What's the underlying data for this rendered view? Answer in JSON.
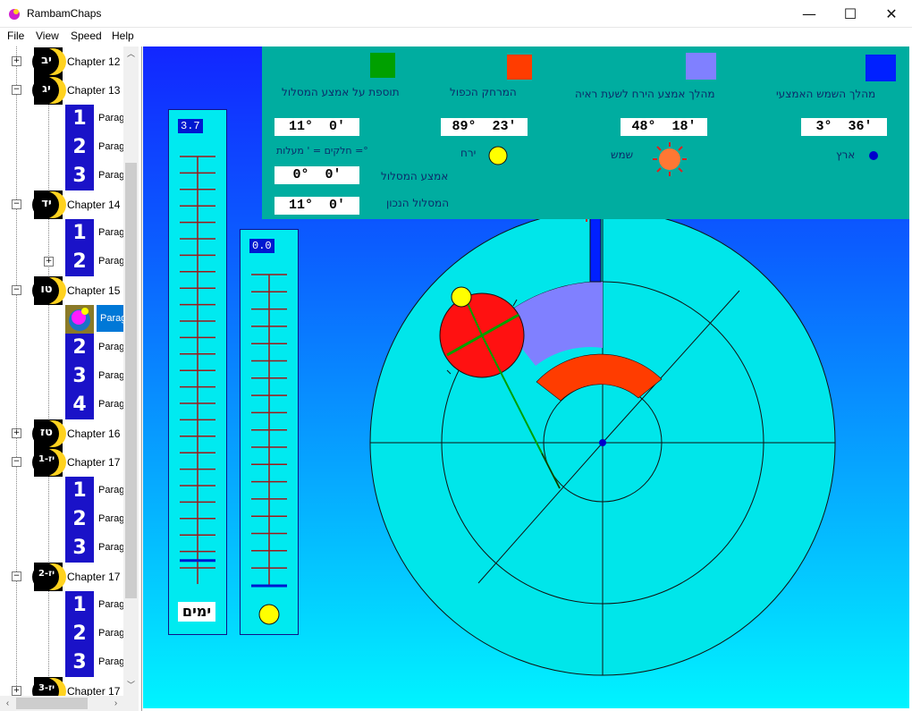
{
  "window": {
    "title": "RambamChaps",
    "minimize": "—",
    "maximize": "☐",
    "close": "✕"
  },
  "menu": [
    "File",
    "View",
    "Speed",
    "Help"
  ],
  "tree": {
    "chapters": [
      {
        "label": "Chapter 12",
        "num": "יב",
        "expander": "+"
      },
      {
        "label": "Chapter 13",
        "num": "יג",
        "expander": "−"
      },
      {
        "label": "Chapter 14",
        "num": "יד",
        "expander": "−"
      },
      {
        "label": "Chapter 15",
        "num": "טו",
        "expander": "−"
      },
      {
        "label": "Chapter 16",
        "num": "טז",
        "expander": "+"
      },
      {
        "label": "Chapter 17",
        "num": "1-יז",
        "expander": "−"
      },
      {
        "label": "Chapter 17",
        "num": "2-יז",
        "expander": "−"
      },
      {
        "label": "Chapter 17",
        "num": "3-יז",
        "expander": "+"
      }
    ],
    "paragraph_label": "Parag",
    "selected_label": "Parag",
    "numbers": [
      "1",
      "2",
      "3",
      "4"
    ]
  },
  "legend": {
    "green": {
      "label": "תוספת על אמצע המסלול",
      "color": "#00a000"
    },
    "red": {
      "label": "המרחק הכפול",
      "color": "#ff3c00"
    },
    "lavender": {
      "label": "מהלך אמצע הירח לשעת ראיה",
      "color": "#8080ff"
    },
    "blue": {
      "label": "מהלך השמש האמצעי",
      "color": "#0020ff"
    }
  },
  "values": {
    "addition": "11°  0'",
    "double_distance": "89°  23'",
    "moon_motion": "48°  18'",
    "sun_motion": "3°  36'",
    "mean_course": "0°  0'",
    "true_course": "11°  0'"
  },
  "labels": {
    "units": "חלקים = '  מעלות =°",
    "moon": "ירח",
    "sun": "שמש",
    "earth": "ארץ",
    "mean_course": "אמצע המסלול",
    "true_course": "המסלול הנכון"
  },
  "gauges": {
    "days_value": "3.7",
    "days_label": "ימים",
    "days_level": 0.055,
    "hours_value": "0.0",
    "hours_level": 0.0
  },
  "colors": {
    "moon": "#ffff00",
    "sun": "#ff7733",
    "earth": "#0000cc",
    "epicycle": "#ff1111",
    "disk": "#00e6ea"
  }
}
